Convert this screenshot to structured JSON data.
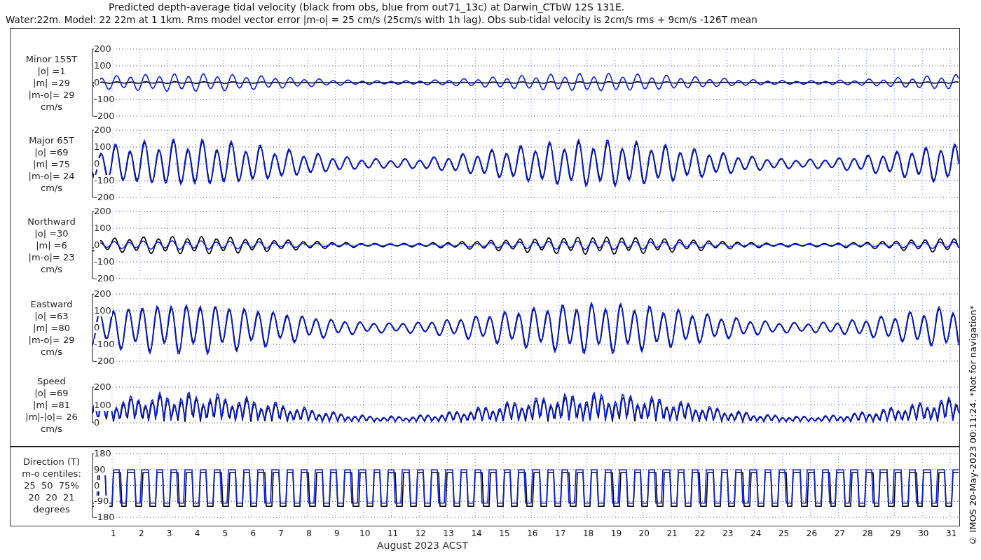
{
  "title": {
    "lines": [
      "Predicted depth-average tidal velocity (black from obs, blue from out71_13c) at Darwin_CTbW 12S 131E.",
      "Water:22m. Model: 22 22m at 1 1km. Rms model vector error |m-o| = 25 cm/s (25cm/s with 1h lag). Obs sub-tidal velocity is 2cm/s rms + 9cm/s -126T mean"
    ]
  },
  "panels": [
    {
      "kind": "signed",
      "label": [
        "Minor 155T",
        "|o| =1",
        "|m| =29",
        "|m-o|= 29",
        "cm/s"
      ],
      "yticks": [
        "200",
        "100",
        "0",
        "-100",
        "-200"
      ]
    },
    {
      "kind": "signed",
      "label": [
        "Major 65T",
        "|o| =69",
        "|m| =75",
        "|m-o|= 24",
        "cm/s"
      ],
      "yticks": [
        "200",
        "100",
        "0",
        "-100",
        "-200"
      ]
    },
    {
      "kind": "signed",
      "label": [
        "Northward",
        "|o| =30",
        "|m| =6",
        "|m-o|= 23",
        "cm/s"
      ],
      "yticks": [
        "200",
        "100",
        "0",
        "-100",
        "-200"
      ]
    },
    {
      "kind": "signed",
      "label": [
        "Eastward",
        "|o| =63",
        "|m| =80",
        "|m-o|= 29",
        "cm/s"
      ],
      "yticks": [
        "200",
        "100",
        "0",
        "-100",
        "-200"
      ]
    },
    {
      "kind": "speed",
      "label": [
        "Speed",
        "|o| =69",
        "|m| =81",
        "|m|-|o|= 26",
        "cm/s"
      ],
      "yticks": [
        "200",
        "100",
        "0"
      ]
    },
    {
      "kind": "direction",
      "label": [
        "Direction (T)",
        "m-o centiles:",
        "25  50  75%",
        "20  20  21",
        "degrees"
      ],
      "yticks": [
        "180",
        "90",
        "0",
        "-90",
        "-180"
      ]
    }
  ],
  "xticks": [
    "1",
    "2",
    "3",
    "4",
    "5",
    "6",
    "7",
    "8",
    "9",
    "10",
    "11",
    "12",
    "13",
    "14",
    "15",
    "16",
    "17",
    "18",
    "19",
    "20",
    "21",
    "22",
    "23",
    "24",
    "25",
    "26",
    "27",
    "28",
    "29",
    "30",
    "31"
  ],
  "xlabel": "August 2023 ACST",
  "footer": "© IMOS 20-May-2023 00:11:24.  *Not for navigation*"
}
